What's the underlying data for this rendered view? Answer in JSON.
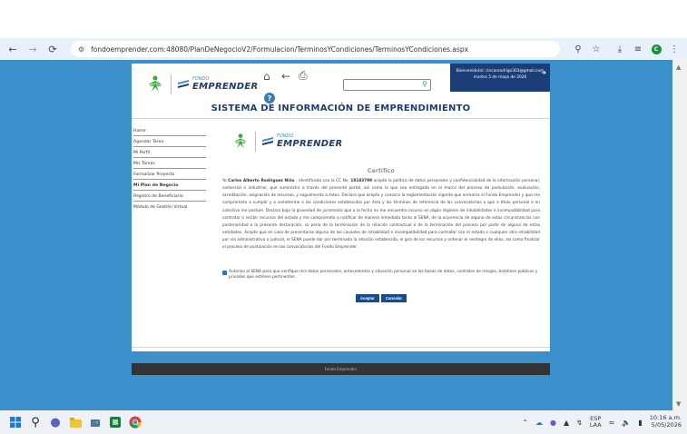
{
  "browser": {
    "url": "fondoemprender.com:48080/PlanDeNegocioV2/Formulacion/TerminosYCondiciones/TerminosYCondiciones.aspx",
    "profile_initial": "C"
  },
  "header": {
    "fondo_small": "FONDO",
    "brand": "EMPRENDER",
    "user_greeting": "Bienvenido(a) :rinconrodrigo303@gmail.com",
    "date": "martes 5 de mayo de 2026",
    "system_title": "SISTEMA DE INFORMACIÓN DE EMPRENDIMIENTO"
  },
  "sidebar": {
    "items": [
      {
        "label": "Home"
      },
      {
        "label": "Agendar Tarea"
      },
      {
        "label": "Mi Perfil"
      },
      {
        "label": "Mis Tareas"
      },
      {
        "label": "Formalizar Proyecto"
      },
      {
        "label": "Mi Plan de Negocio"
      },
      {
        "label": "Registro de Beneficiario"
      },
      {
        "label": "Módulo de Gestión Virtual"
      }
    ]
  },
  "main": {
    "heading": "Certifico",
    "cert_intro": "Yo ",
    "cert_name": "Carlos Alberto Rodriguez Niño",
    "cert_mid": " , identificado con la CC No. ",
    "cert_id": "18183799",
    "cert_body": " acepto la política de datos personales y confidencialidad de la información personal, comercial e industrial, que suministro a través del presente portal, así como la que sea entregada en el marco del proceso de postulación, evaluación, acreditación, asignación de recursos, y seguimiento a éstos. Declaro que acepto y conozco la reglamentación vigente que enmarca el Fondo Emprender y que me comprometo a cumplir y a someterme a las condiciones establecidas por ésta y los términos de referencia de las convocatorias a que a título personal o en colectivo me postule. Declaro bajo la gravedad de juramento que a la fecha no me encuentro incurso en algún régimen de inhabilidades e incompatibilidad para contratar o recibir recursos del estado y me comprometo a notificar de manera inmediata tanto al SENA, de la ocurrencia de alguna de estas circunstancias con posterioridad a la presente declaración, so pena de la terminación de la relación contractual o de la terminación del proceso por parte de alguna de estas entidades. Acepto que en caso de presentarse alguna de las causales de inhabilidad e incompatibilidad para contratar con el estado o cualquier otra inhabilidad por vía administrativa o judicial, el SENA puede dar por terminada la relación establecida, el giro de los recursos y ordenar el reintegro de ellos, así como finalizar el proceso de postulación en las convocatorias del Fondo Emprender.",
    "consent_checked": true,
    "consent_text": "Autorizo al SENA para que verifique mis datos personales, antecedentes y situación personal en las bases de datos, centrales de riesgos, boletines públicos y privados que estimen pertinentes.",
    "accept_label": "Aceptar",
    "cancel_label": "Cancelar"
  },
  "footer": {
    "text": "Fondo Emprender"
  },
  "taskbar": {
    "lang_line1": "ESP",
    "lang_line2": "LAA",
    "time": "10:16 a.m.",
    "date": "5/05/2026"
  },
  "colors": {
    "page_bg": "#3b8fcb",
    "navy": "#1b3e78",
    "button": "#1b4a8a",
    "footer": "#333333"
  }
}
